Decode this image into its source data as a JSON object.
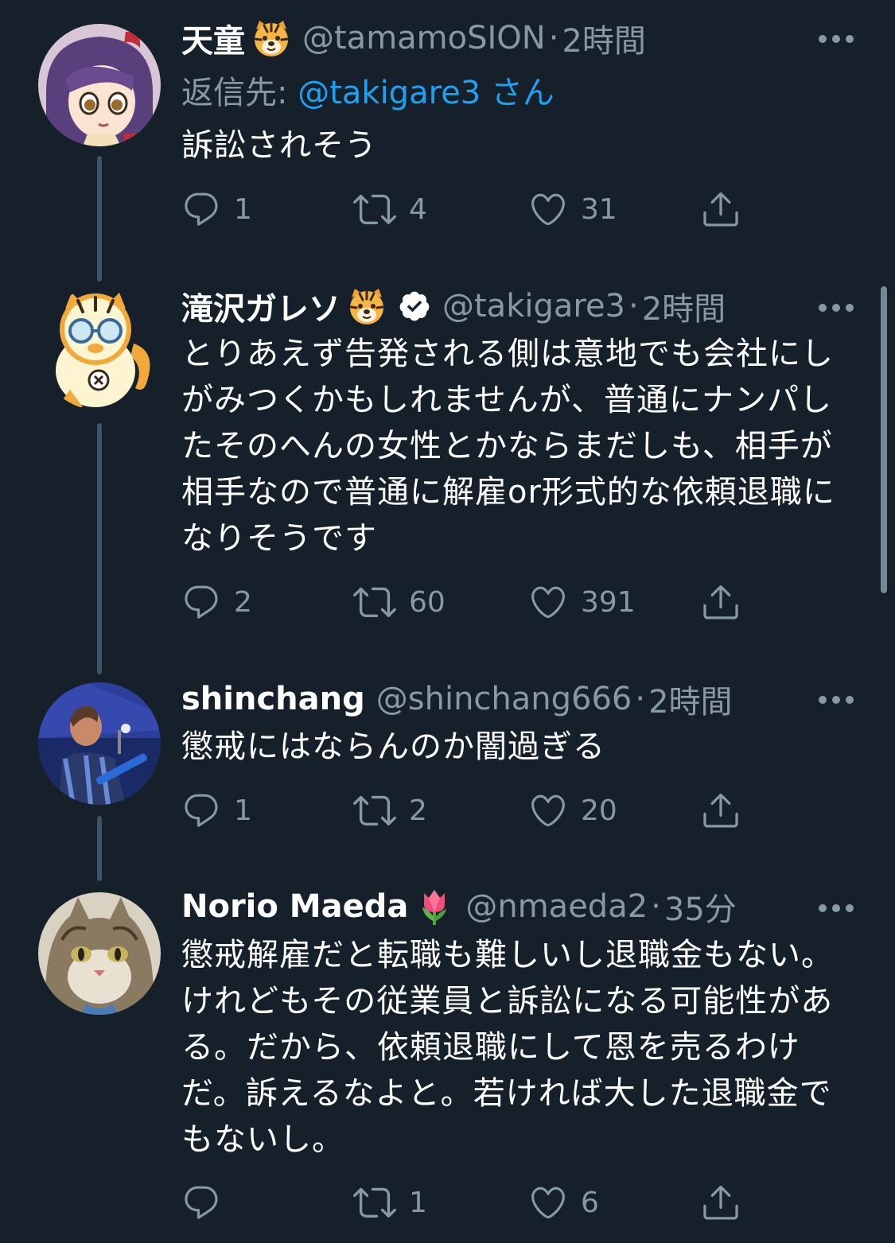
{
  "tweets": [
    {
      "name": "天童",
      "name_emoji": "tiger-face",
      "verified": false,
      "handle": "@tamamoSION",
      "time": "2時間",
      "reply_prefix": "返信先: ",
      "reply_mention": "@takigare3",
      "reply_suffix": " さん",
      "text": "訴訟されそう",
      "replies": "1",
      "retweets": "4",
      "likes": "31"
    },
    {
      "name": "滝沢ガレソ",
      "name_emoji": "tiger-face",
      "verified": true,
      "handle": "@takigare3",
      "time": "2時間",
      "text": "とりあえず告発される側は意地でも会社にしがみつくかもしれませんが、普通にナンパしたそのへんの女性とかならまだしも、相手が相手なので普通に解雇or形式的な依頼退職になりそうです",
      "replies": "2",
      "retweets": "60",
      "likes": "391"
    },
    {
      "name": "shinchang",
      "handle": "@shinchang666",
      "time": "2時間",
      "text": "懲戒にはならんのか闇過ぎる",
      "replies": "1",
      "retweets": "2",
      "likes": "20"
    },
    {
      "name": "Norio Maeda",
      "name_emoji": "tulip",
      "handle": "@nmaeda2",
      "time": "35分",
      "text": "懲戒解雇だと転職も難しいし退職金もない。けれどもその従業員と訴訟になる可能性がある。だから、依頼退職にして恩を売るわけだ。訴えるなよと。若ければ大した退職金でもないし。",
      "replies": "",
      "retweets": "1",
      "likes": "6"
    }
  ],
  "separator": "·",
  "colors": {
    "background": "#15202b",
    "text": "#ffffff",
    "secondary": "#8899a6",
    "link": "#1da1f2",
    "thread_line": "#3d5466"
  }
}
